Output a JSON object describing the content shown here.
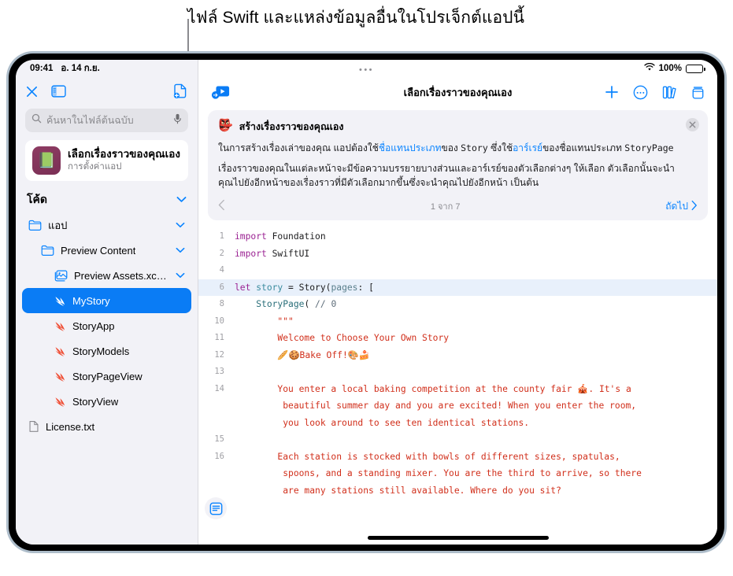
{
  "callout": {
    "text": "ไฟล์ Swift และแหล่งข้อมูลอื่นในโปรเจ็กต์แอปนี้"
  },
  "status_bar": {
    "time": "09:41",
    "date": "อ. 14 ก.ย.",
    "battery_percent": "100%",
    "wifi_icon": "wifi-icon",
    "battery_icon": "battery-icon"
  },
  "sidebar": {
    "toolbar": {
      "close_icon": "close-icon",
      "sidebar_toggle_icon": "sidebar-toggle-icon",
      "new_file_icon": "new-file-icon"
    },
    "search": {
      "placeholder": "ค้นหาในไฟล์ต้นฉบับ",
      "search_icon": "search-icon",
      "mic_icon": "microphone-icon"
    },
    "project": {
      "name": "เลือกเรื่องราวของคุณเอง",
      "subtitle": "การตั้งค่าแอป",
      "icon": "📗"
    },
    "section": {
      "title": "โค้ด",
      "chevron": "chevron-down-icon"
    },
    "tree": [
      {
        "label": "แอป",
        "type": "folder",
        "indent": 1,
        "expanded": true,
        "selected": false
      },
      {
        "label": "Preview Content",
        "type": "folder",
        "indent": 2,
        "expanded": true,
        "selected": false
      },
      {
        "label": "Preview Assets.xcass...",
        "type": "assets",
        "indent": 3,
        "expanded": true,
        "selected": false
      },
      {
        "label": "MyStory",
        "type": "swift",
        "indent": 3,
        "expanded": false,
        "selected": true
      },
      {
        "label": "StoryApp",
        "type": "swift",
        "indent": 3,
        "expanded": false,
        "selected": false
      },
      {
        "label": "StoryModels",
        "type": "swift",
        "indent": 3,
        "expanded": false,
        "selected": false
      },
      {
        "label": "StoryPageView",
        "type": "swift",
        "indent": 3,
        "expanded": false,
        "selected": false
      },
      {
        "label": "StoryView",
        "type": "swift",
        "indent": 3,
        "expanded": false,
        "selected": false
      },
      {
        "label": "License.txt",
        "type": "text",
        "indent": 1,
        "expanded": false,
        "selected": false
      }
    ]
  },
  "main": {
    "toolbar": {
      "run_icon": "run-preview-icon",
      "title": "เลือกเรื่องราวของคุณเอง",
      "add_icon": "plus-icon",
      "more_icon": "ellipsis-circle-icon",
      "library_icon": "library-icon",
      "layers_icon": "layers-icon"
    },
    "info_card": {
      "emoji": "👺",
      "title": "สร้างเรื่องราวของคุณเอง",
      "close_icon": "close-icon",
      "paragraph1_a": "ในการสร้างเรื่องเล่าของคุณ แอปต้องใช้",
      "paragraph1_link1": "ชื่อแทนประเภท",
      "paragraph1_b": "ของ ",
      "paragraph1_mono1": "Story",
      "paragraph1_c": " ซึ่งใช้",
      "paragraph1_link2": "อาร์เรย์",
      "paragraph1_d": "ของชื่อแทนประเภท ",
      "paragraph1_mono2": "StoryPage",
      "paragraph2": "เรื่องราวของคุณในแต่ละหน้าจะมีข้อความบรรยายบางส่วนและอาร์เรย์ของตัวเลือกต่างๆ ให้เลือก ตัวเลือกนั้นจะนำคุณไปยังอีกหน้าของเรื่องราวที่มีตัวเลือกมากขึ้นซึ่งจะนำคุณไปยังอีกหน้า เป็นต้น",
      "prev_icon": "chevron-left-icon",
      "page_count": "1 จาก 7",
      "next_label": "ถัดไป",
      "next_icon": "chevron-right-icon"
    },
    "editor": {
      "assistant_icon": "document-assistant-icon",
      "lines": [
        {
          "num": "1",
          "highlight": false,
          "tokens": [
            {
              "t": "import",
              "c": "k-kw"
            },
            {
              "t": " Foundation",
              "c": "k-plain"
            }
          ]
        },
        {
          "num": "2",
          "highlight": false,
          "tokens": [
            {
              "t": "import",
              "c": "k-kw"
            },
            {
              "t": " SwiftUI",
              "c": "k-plain"
            }
          ]
        },
        {
          "num": "4",
          "highlight": false,
          "tokens": []
        },
        {
          "num": "6",
          "highlight": true,
          "tokens": [
            {
              "t": "let",
              "c": "k-kw"
            },
            {
              "t": " ",
              "c": "k-plain"
            },
            {
              "t": "story",
              "c": "k-var"
            },
            {
              "t": " = ",
              "c": "k-plain"
            },
            {
              "t": "Story",
              "c": "k-plain"
            },
            {
              "t": "(",
              "c": "k-plain"
            },
            {
              "t": "pages",
              "c": "k-param"
            },
            {
              "t": ": [",
              "c": "k-plain"
            }
          ]
        },
        {
          "num": "8",
          "highlight": false,
          "tokens": [
            {
              "t": "    ",
              "c": "k-plain"
            },
            {
              "t": "StoryPage",
              "c": "k-type"
            },
            {
              "t": "( ",
              "c": "k-plain"
            },
            {
              "t": "// 0",
              "c": "k-com"
            }
          ]
        },
        {
          "num": "10",
          "highlight": false,
          "tokens": [
            {
              "t": "        ",
              "c": "k-plain"
            },
            {
              "t": "\"\"\"",
              "c": "k-str"
            }
          ]
        },
        {
          "num": "11",
          "highlight": false,
          "tokens": [
            {
              "t": "        Welcome to Choose Your Own Story",
              "c": "k-str"
            }
          ]
        },
        {
          "num": "12",
          "highlight": false,
          "tokens": [
            {
              "t": "        🥖🍪Bake Off!🎨🍰",
              "c": "k-str"
            }
          ]
        },
        {
          "num": "13",
          "highlight": false,
          "tokens": []
        },
        {
          "num": "14",
          "highlight": false,
          "tokens": [
            {
              "t": "        You enter a local baking competition at the county fair 🎪. It's a",
              "c": "k-str"
            }
          ]
        },
        {
          "num": "",
          "highlight": false,
          "tokens": [
            {
              "t": "         beautiful summer day and you are excited! When you enter the room,",
              "c": "k-str"
            }
          ]
        },
        {
          "num": "",
          "highlight": false,
          "tokens": [
            {
              "t": "         you look around to see ten identical stations.",
              "c": "k-str"
            }
          ]
        },
        {
          "num": "15",
          "highlight": false,
          "tokens": []
        },
        {
          "num": "16",
          "highlight": false,
          "tokens": [
            {
              "t": "        Each station is stocked with bowls of different sizes, spatulas,",
              "c": "k-str"
            }
          ]
        },
        {
          "num": "",
          "highlight": false,
          "tokens": [
            {
              "t": "         spoons, and a standing mixer. You are the third to arrive, so there",
              "c": "k-str"
            }
          ]
        },
        {
          "num": "",
          "highlight": false,
          "tokens": [
            {
              "t": "         are many stations still available. Where do you sit?",
              "c": "k-str"
            }
          ]
        }
      ]
    }
  },
  "colors": {
    "accent": "#0a84ff",
    "selection": "#0a7cf5",
    "string": "#d12f1b",
    "keyword": "#9b2393",
    "bezel": "#aebdca"
  }
}
